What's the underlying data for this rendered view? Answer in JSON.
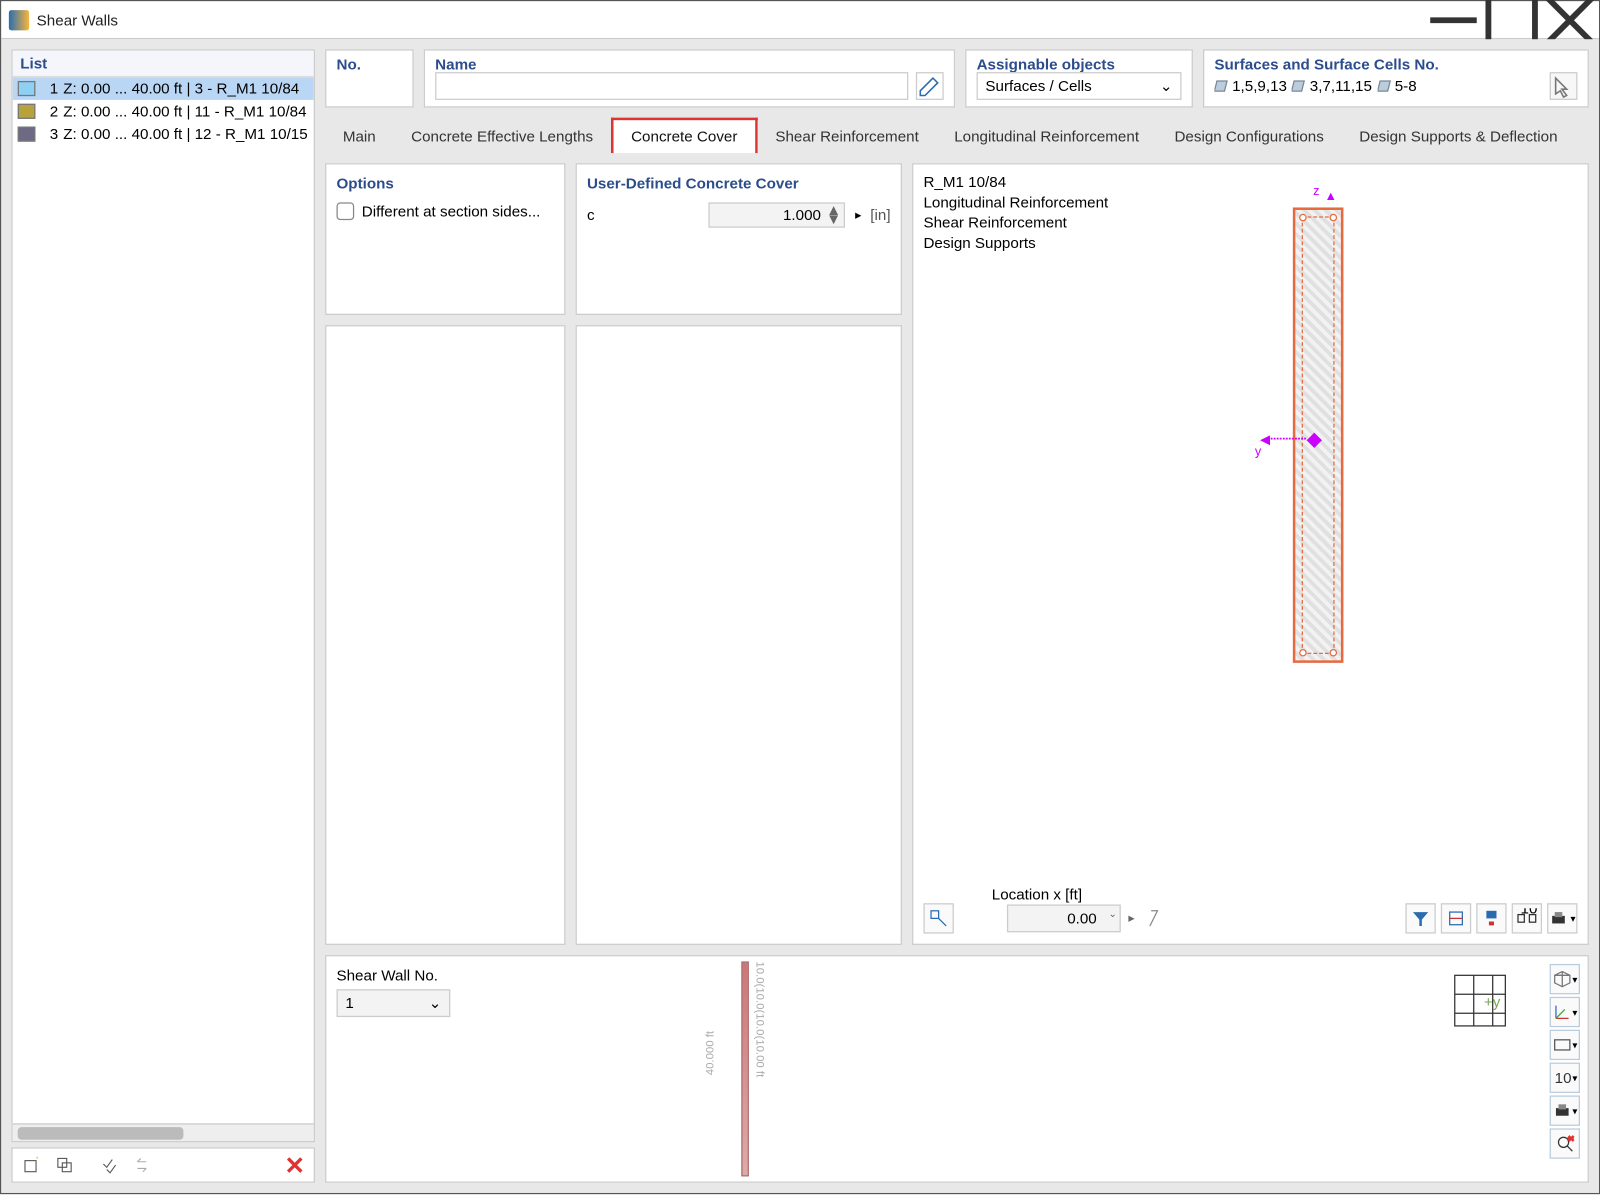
{
  "window": {
    "title": "Shear Walls"
  },
  "list": {
    "header": "List",
    "rows": [
      {
        "no": "1",
        "label": "Z: 0.00 ... 40.00 ft | 3 - R_M1 10/84",
        "color": "#8ed0f2",
        "selected": true
      },
      {
        "no": "2",
        "label": "Z: 0.00 ... 40.00 ft | 11 - R_M1 10/84",
        "color": "#b7a23b",
        "selected": false
      },
      {
        "no": "3",
        "label": "Z: 0.00 ... 40.00 ft | 12 - R_M1 10/15",
        "color": "#6e6a86",
        "selected": false
      }
    ]
  },
  "header_cards": {
    "no": "No.",
    "name": "Name",
    "assignable": "Assignable objects",
    "assignable_value": "Surfaces / Cells",
    "surfaces_header": "Surfaces and Surface Cells No.",
    "surfaces_groups": [
      "1,5,9,13",
      "3,7,11,15",
      "5-8"
    ]
  },
  "tabs": [
    "Main",
    "Concrete Effective Lengths",
    "Concrete Cover",
    "Shear Reinforcement",
    "Longitudinal Reinforcement",
    "Design Configurations",
    "Design Supports & Deflection"
  ],
  "active_tab": 2,
  "options": {
    "header": "Options",
    "checkbox": "Different at section sides..."
  },
  "cover": {
    "header": "User-Defined Concrete Cover",
    "label": "c",
    "value": "1.000",
    "unit": "[in]"
  },
  "preview": {
    "lines": [
      "R_M1 10/84",
      "Longitudinal Reinforcement",
      "Shear Reinforcement",
      "Design Supports"
    ],
    "loc_label": "Location x [ft]",
    "loc_value": "0.00",
    "axis_z": "z",
    "axis_y": "y"
  },
  "bottom": {
    "header": "Shear Wall No.",
    "value": "1",
    "beam_len": "40.000 ft",
    "seg": "10.0(10.0(10.0(10.00 ft"
  }
}
